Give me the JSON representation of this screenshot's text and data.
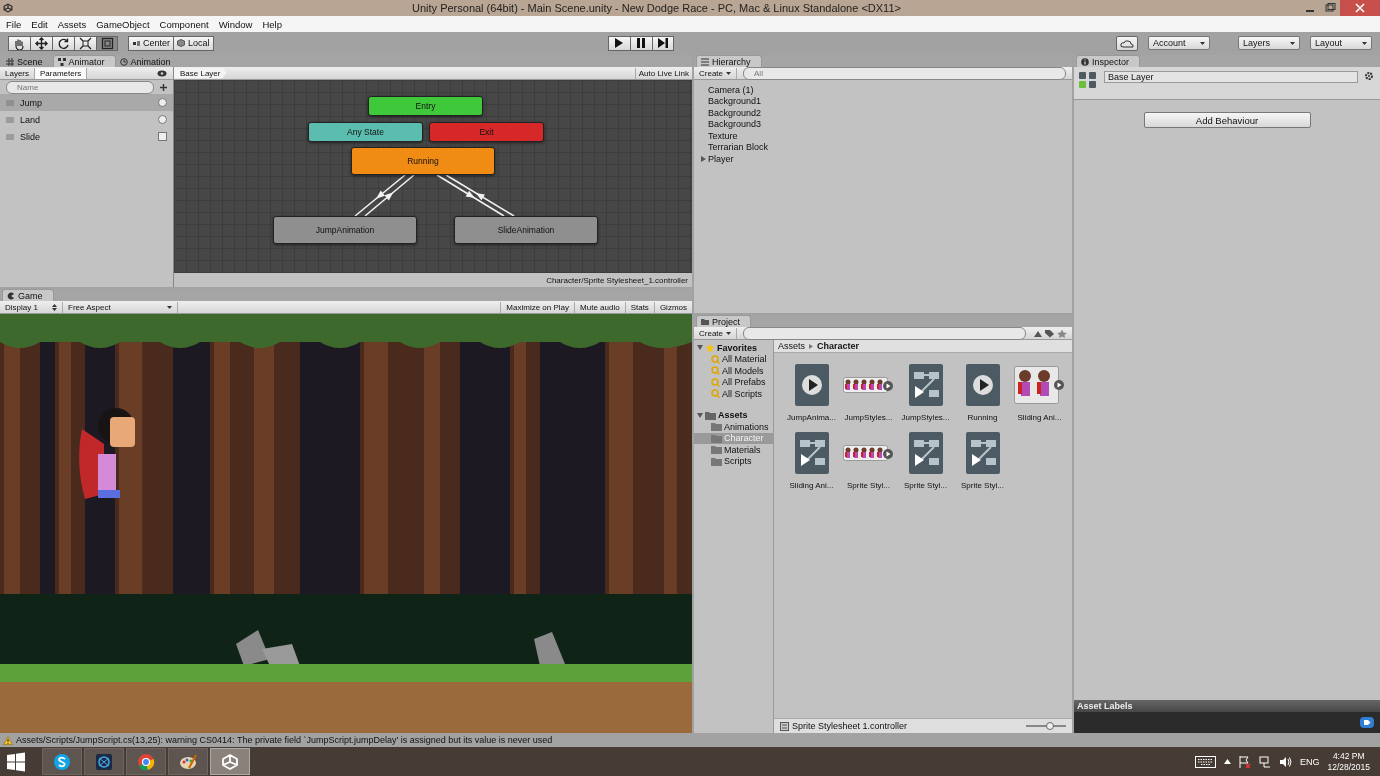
{
  "window": {
    "title": "Unity Personal (64bit) - Main Scene.unity - New Dodge Race - PC, Mac & Linux Standalone <DX11>"
  },
  "menu": [
    "File",
    "Edit",
    "Assets",
    "GameObject",
    "Component",
    "Window",
    "Help"
  ],
  "toolbar": {
    "tools": [
      {
        "kind": "hand",
        "selected": false
      },
      {
        "kind": "move",
        "selected": false
      },
      {
        "kind": "rotate",
        "selected": false
      },
      {
        "kind": "scale",
        "selected": false
      },
      {
        "kind": "rect",
        "selected": true
      }
    ],
    "pivot": [
      "Center",
      "Local"
    ],
    "playback": [
      {
        "kind": "play"
      },
      {
        "kind": "pause"
      },
      {
        "kind": "step"
      }
    ],
    "right": [
      "Account",
      "Layers",
      "Layout"
    ]
  },
  "animator": {
    "tabs": [
      {
        "label": "Scene",
        "kind": "scene",
        "selected": false
      },
      {
        "label": "Animator",
        "kind": "animator",
        "selected": true
      },
      {
        "label": "Animation",
        "kind": "animation",
        "selected": false
      }
    ],
    "subtabs": [
      {
        "label": "Layers",
        "selected": false
      },
      {
        "label": "Parameters",
        "selected": true
      }
    ],
    "search": {
      "placeholder": "Name"
    },
    "parameters": [
      {
        "name": "Jump",
        "kind": "trigger",
        "selected": true
      },
      {
        "name": "Land",
        "kind": "trigger",
        "selected": false
      },
      {
        "name": "Slide",
        "kind": "bool",
        "selected": false
      }
    ],
    "breadcrumb": "Base Layer",
    "live_link": "Auto Live Link",
    "states": [
      {
        "name": "Entry",
        "kind": "entry"
      },
      {
        "name": "Any State",
        "kind": "any"
      },
      {
        "name": "Exit",
        "kind": "exit"
      },
      {
        "name": "Running",
        "kind": "default"
      },
      {
        "name": "JumpAnimation",
        "kind": "normal"
      },
      {
        "name": "SlideAnimation",
        "kind": "normal"
      }
    ],
    "footer": "Character/Sprite Stylesheet_1.controller"
  },
  "hierarchy": {
    "tab": "Hierarchy",
    "create": "Create",
    "search": {
      "placeholder": "All"
    },
    "items": [
      {
        "name": "Camera (1)",
        "has_children": false
      },
      {
        "name": "Background1",
        "has_children": false
      },
      {
        "name": "Background2",
        "has_children": false
      },
      {
        "name": "Background3",
        "has_children": false
      },
      {
        "name": "Texture",
        "has_children": false
      },
      {
        "name": "Terrarian Block",
        "has_children": false
      },
      {
        "name": "Player",
        "has_children": true
      }
    ]
  },
  "game": {
    "tab": "Game",
    "display": "Display 1",
    "aspect": "Free Aspect",
    "buttons": [
      "Maximize on Play",
      "Mute audio",
      "Stats",
      "Gizmos"
    ]
  },
  "project": {
    "tab": "Project",
    "create": "Create",
    "favorites": {
      "label": "Favorites",
      "expanded": true,
      "items": [
        "All Material",
        "All Models",
        "All Prefabs",
        "All Scripts"
      ]
    },
    "assets": {
      "label": "Assets",
      "expanded": true,
      "folders": [
        {
          "name": "Animations",
          "selected": false
        },
        {
          "name": "Character",
          "selected": true
        },
        {
          "name": "Materials",
          "selected": false
        },
        {
          "name": "Scripts",
          "selected": false
        }
      ]
    },
    "breadcrumb": [
      "Assets",
      "Character"
    ],
    "files": [
      {
        "name": "JumpAnima...",
        "kind": "clip"
      },
      {
        "name": "JumpStyles...",
        "kind": "sheet"
      },
      {
        "name": "JumpStyles...",
        "kind": "controller"
      },
      {
        "name": "Running",
        "kind": "clip"
      },
      {
        "name": "Sliding Ani...",
        "kind": "pair"
      },
      {
        "name": "Sliding Ani...",
        "kind": "controller"
      },
      {
        "name": "Sprite Styl...",
        "kind": "sheet"
      },
      {
        "name": "Sprite Styl...",
        "kind": "controller"
      },
      {
        "name": "Sprite Styl...",
        "kind": "controller"
      }
    ],
    "footer": "Sprite Stylesheet  1.controller",
    "zoom": {
      "level": 0.6
    }
  },
  "inspector": {
    "tab": "Inspector",
    "name": "Base Layer",
    "button": "Add Behaviour",
    "labels": "Asset Labels"
  },
  "status": "Assets/Scripts/JumpScript.cs(13,25): warning CS0414: The private field `JumpScript.jumpDelay' is assigned but its value is never used",
  "taskbar": {
    "apps": [
      {
        "kind": "skype",
        "selected": false
      },
      {
        "kind": "blender",
        "selected": false
      },
      {
        "kind": "chrome",
        "selected": false
      },
      {
        "kind": "paint",
        "selected": false
      },
      {
        "kind": "unity",
        "selected": true
      }
    ],
    "language": "ENG",
    "time": "4:42 PM",
    "date": "12/28/2015"
  }
}
